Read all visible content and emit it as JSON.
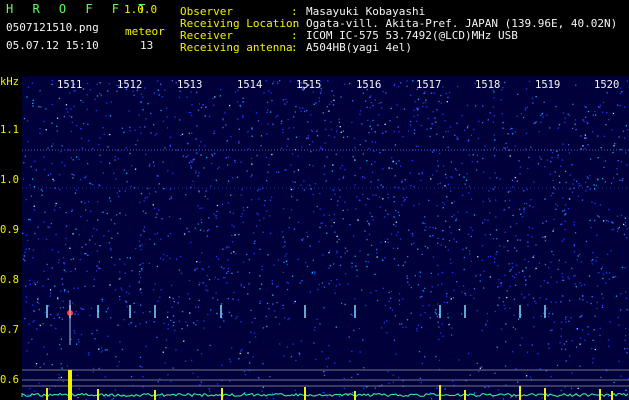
{
  "app": {
    "name": "H R O F F T",
    "version": "1.0.0"
  },
  "file": {
    "name": "0507121510.png",
    "datetime": "05.07.12 15:10"
  },
  "detector": {
    "label": "meteor",
    "count": "13"
  },
  "info": [
    {
      "key": "Observer",
      "sep": ":",
      "value": "Masayuki Kobayashi"
    },
    {
      "key": "Receiving Location",
      "sep": ":",
      "value": "Ogata-vill. Akita-Pref. JAPAN (139.96E, 40.02N)"
    },
    {
      "key": "Receiver",
      "sep": ":",
      "value": "ICOM IC-575 53.7492(@LCD)MHz USB"
    },
    {
      "key": "Receiving antenna",
      "sep": ":",
      "value": "A504HB(yagi 4el)"
    }
  ],
  "y_axis": {
    "unit": "kHz",
    "ticks": [
      "1.1",
      "1.0",
      "0.9",
      "0.8",
      "0.7",
      "0.6"
    ]
  },
  "x_axis": {
    "ticks": [
      "1511",
      "1512",
      "1513",
      "1514",
      "1515",
      "1516",
      "1517",
      "1518",
      "1519",
      "1520"
    ]
  },
  "colors": {
    "background": "#000000",
    "spectrum_bg": "#00003a",
    "noise": "#1f3fff",
    "label": "#f2f200",
    "title": "#5dff5d",
    "text": "#f4f4f4",
    "echo": "#ff3a3a",
    "level": "#3cff9a"
  }
}
